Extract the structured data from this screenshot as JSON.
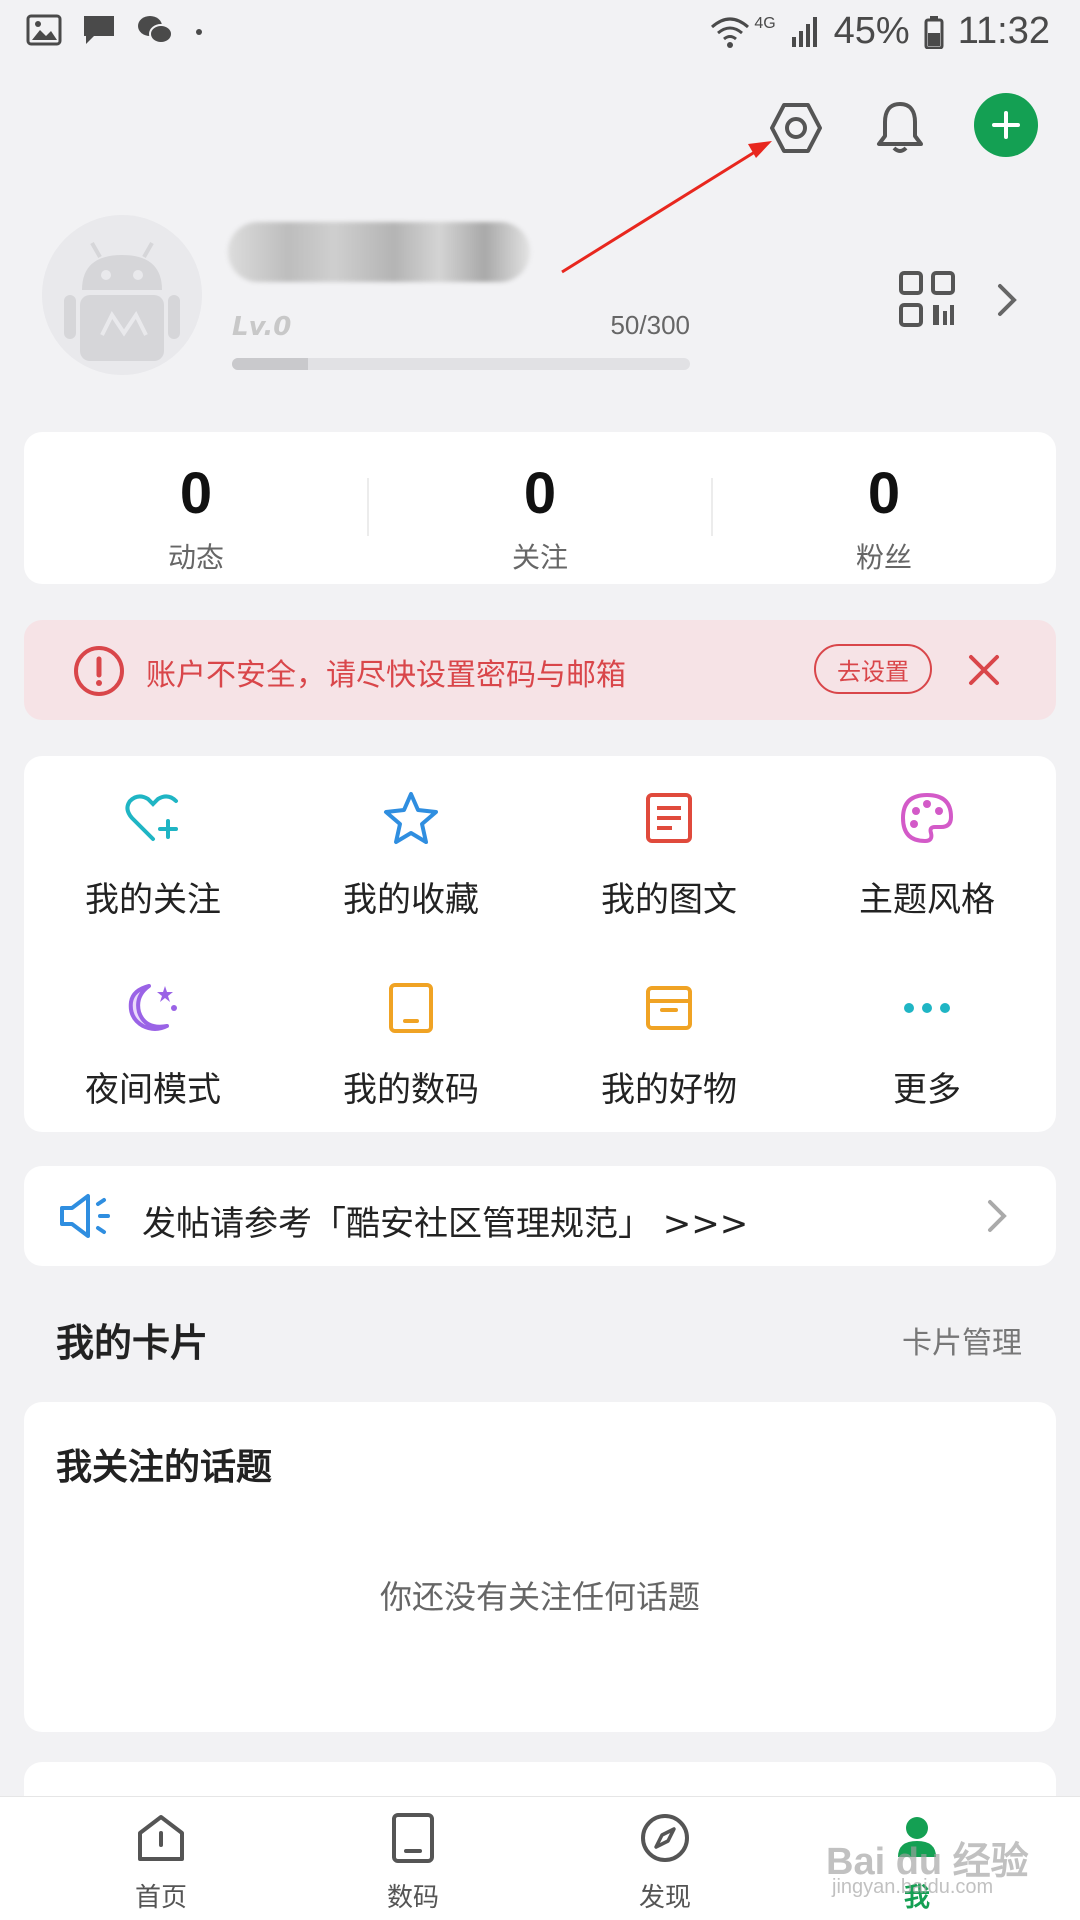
{
  "status_bar": {
    "battery": "45%",
    "time": "11:32",
    "network": "4G"
  },
  "profile": {
    "level": "Lv.0",
    "exp": "50/300",
    "exp_fraction": 0.1667
  },
  "stats": [
    {
      "value": "0",
      "label": "动态"
    },
    {
      "value": "0",
      "label": "关注"
    },
    {
      "value": "0",
      "label": "粉丝"
    }
  ],
  "warning": {
    "text": "账户不安全，请尽快设置密码与邮箱",
    "button": "去设置"
  },
  "grid": [
    {
      "label": "我的关注",
      "icon": "heart-plus-icon",
      "color": "#1fb5c4"
    },
    {
      "label": "我的收藏",
      "icon": "star-icon",
      "color": "#2f8ee0"
    },
    {
      "label": "我的图文",
      "icon": "document-icon",
      "color": "#e04a3c"
    },
    {
      "label": "主题风格",
      "icon": "palette-icon",
      "color": "#d35ac8"
    },
    {
      "label": "夜间模式",
      "icon": "moon-icon",
      "color": "#9a63e6"
    },
    {
      "label": "我的数码",
      "icon": "tablet-icon",
      "color": "#f0a324"
    },
    {
      "label": "我的好物",
      "icon": "box-icon",
      "color": "#f0a324"
    },
    {
      "label": "更多",
      "icon": "more-dots-icon",
      "color": "#1fb5c4"
    }
  ],
  "notice": {
    "text": "发帖请参考「酷安社区管理规范」 >>>"
  },
  "cards_section": {
    "title": "我的卡片",
    "manage_link": "卡片管理"
  },
  "topic_card": {
    "title": "我关注的话题",
    "empty_text": "你还没有关注任何话题"
  },
  "bottom_nav": [
    {
      "label": "首页",
      "icon": "home-icon"
    },
    {
      "label": "数码",
      "icon": "tablet-icon"
    },
    {
      "label": "发现",
      "icon": "compass-icon"
    },
    {
      "label": "我",
      "icon": "profile-icon"
    }
  ],
  "watermark": {
    "brand": "Bai du 经验",
    "url": "jingyan.baidu.com"
  },
  "colors": {
    "accent": "#14a053",
    "warning": "#d9464a",
    "annotation_arrow": "#e8271e"
  }
}
